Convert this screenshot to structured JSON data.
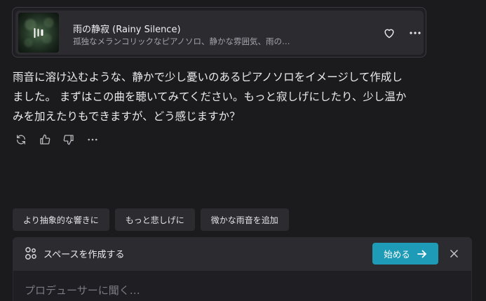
{
  "track": {
    "title": "雨の静寂 (Rainy Silence)",
    "description": "孤独なメランコリックなピアノソロ、静かな雰囲気、雨の…",
    "cover_icon": "pause-icon",
    "like_icon": "heart-icon",
    "more_icon": "more-horizontal-icon"
  },
  "message": {
    "lines": [
      "雨音に溶け込むような、静かで少し憂いのあるピアノソロをイメージして作成し",
      "ました。 まずはこの曲を聴いてみてください。もっと寂しげにしたり、少し温か",
      "みを加えたりもできますが、どう感じますか？"
    ]
  },
  "actions": [
    "regenerate-icon",
    "thumbs-up-icon",
    "thumbs-down-icon",
    "more-horizontal-icon"
  ],
  "suggestions": [
    "より抽象的な響きに",
    "もっと悲しげに",
    "微かな雨音を追加"
  ],
  "space": {
    "label": "スペースを作成する",
    "start_label": "始める",
    "icon": "space-icon",
    "close_icon": "close-icon"
  },
  "composer": {
    "placeholder": "プロデューサーに聞く…",
    "value": ""
  },
  "colors": {
    "background": "#1b1b1e",
    "card": "#2b2b30",
    "accent": "#1e9bb6"
  }
}
